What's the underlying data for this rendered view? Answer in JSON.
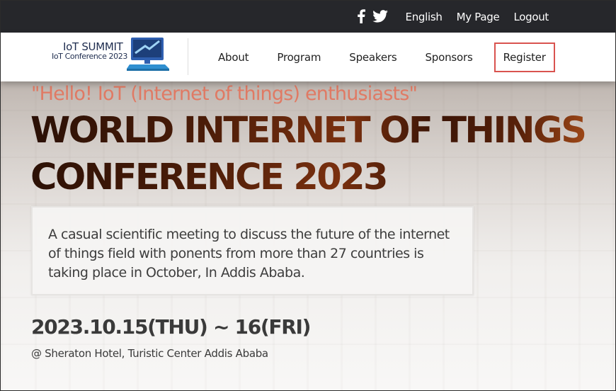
{
  "topbar": {
    "social_icons": [
      "facebook-icon",
      "twitter-icon"
    ],
    "links": [
      "English",
      "My Page",
      "Logout"
    ]
  },
  "logo": {
    "line1": "IoT SUMMIT",
    "line2": "IoT Conference 2023"
  },
  "nav": {
    "about": "About",
    "program": "Program",
    "speakers": "Speakers",
    "sponsors": "Sponsors",
    "register": "Register"
  },
  "hero": {
    "greeting": "\"Hello! IoT (Internet of things) enthusiasts\"",
    "headline_line1": "WORLD INTERNET OF THINGS",
    "headline_line2": "CONFERENCE 2023",
    "description": "A casual scientific meeting to discuss the future of the internet of things field with ponents from more than 27 countries is taking place in October, In Addis Ababa.",
    "date": "2023.10.15(THU) ~ 16(FRI)",
    "venue": "@ Sheraton Hotel, Turistic Center Addis Ababa"
  },
  "colors": {
    "topbar_bg": "#26272b",
    "register_border": "#d9534f",
    "greeting": "#e07a64",
    "headline": "#3a1608"
  }
}
